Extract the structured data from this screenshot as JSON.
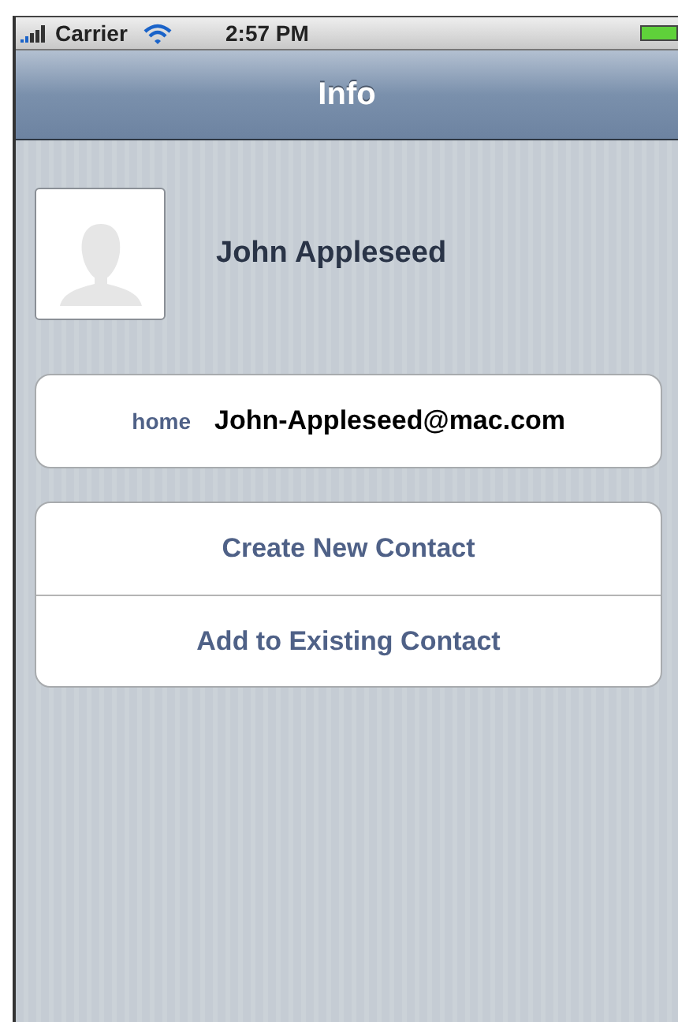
{
  "status_bar": {
    "carrier": "Carrier",
    "time": "2:57 PM"
  },
  "nav_bar": {
    "title": "Info"
  },
  "contact": {
    "name": "John Appleseed"
  },
  "fields": [
    {
      "label": "home",
      "value": "John-Appleseed@mac.com"
    }
  ],
  "actions": [
    "Create New Contact",
    "Add to Existing Contact"
  ]
}
